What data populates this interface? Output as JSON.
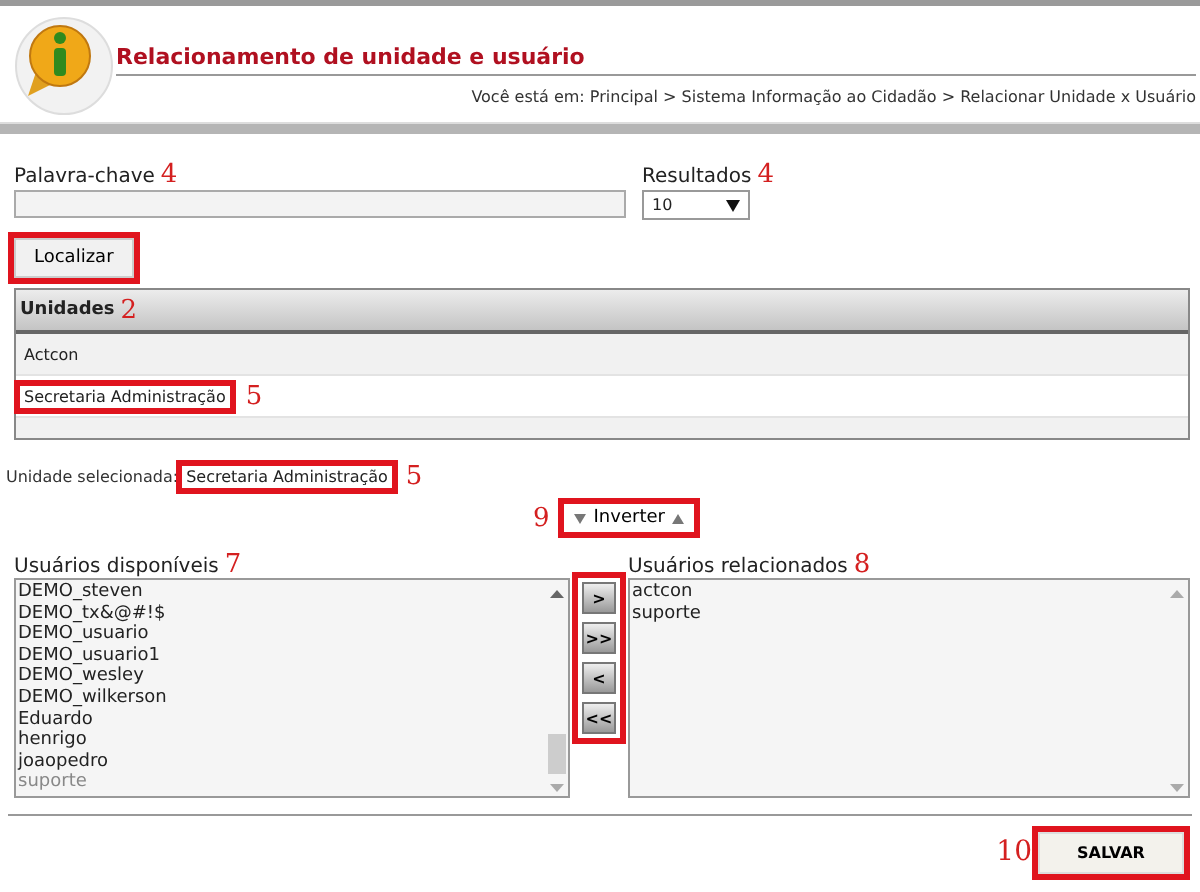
{
  "header": {
    "title": "Relacionamento de unidade e usuário",
    "breadcrumb": "Você está em: Principal > Sistema Informação ao Cidadão > Relacionar Unidade x Usuário"
  },
  "search": {
    "keyword_label": "Palavra-chave",
    "keyword_callout": "4",
    "results_label": "Resultados",
    "results_callout": "4",
    "results_value": "10",
    "find_button": {
      "label": "Localizar",
      "highlighted": true
    }
  },
  "units_table": {
    "header": "Unidades",
    "callout": "2",
    "rows": [
      {
        "name": "Actcon",
        "highlighted": false
      },
      {
        "name": "Secretaria Administração",
        "highlighted": true,
        "callout": "5"
      }
    ]
  },
  "selected_unit": {
    "label": "Unidade selecionada:",
    "value": "Secretaria Administração",
    "highlighted": true,
    "callout": "5"
  },
  "invert_button": {
    "label": "Inverter",
    "callout": "9",
    "highlighted": true
  },
  "available_users": {
    "label": "Usuários disponíveis",
    "callout": "7",
    "items": [
      {
        "name": "DEMO_steven",
        "disabled": false
      },
      {
        "name": "DEMO_tx&@#!$",
        "disabled": false
      },
      {
        "name": "DEMO_usuario",
        "disabled": false
      },
      {
        "name": "DEMO_usuario1",
        "disabled": false
      },
      {
        "name": "DEMO_wesley",
        "disabled": false
      },
      {
        "name": "DEMO_wilkerson",
        "disabled": false
      },
      {
        "name": "Eduardo",
        "disabled": false
      },
      {
        "name": "henrigo",
        "disabled": false
      },
      {
        "name": "joaopedro",
        "disabled": false
      },
      {
        "name": "suporte",
        "disabled": true
      }
    ]
  },
  "transfer_buttons": {
    "highlighted": true,
    "buttons": [
      ">",
      ">>",
      "<",
      "<<"
    ]
  },
  "related_users": {
    "label": "Usuários relacionados",
    "callout": "8",
    "items": [
      "actcon",
      "suporte"
    ]
  },
  "save_button": {
    "label": "SALVAR",
    "callout": "10",
    "highlighted": true
  }
}
